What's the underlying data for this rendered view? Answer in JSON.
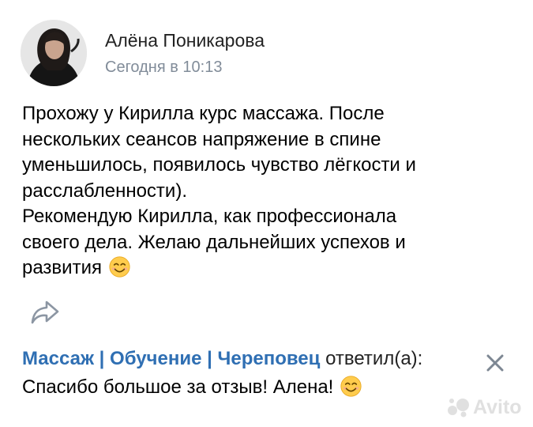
{
  "post": {
    "author": "Алёна Поникарова",
    "time": "Сегодня в 10:13",
    "lines": [
      "Прохожу у Кирилла курс массажа. После",
      "нескольких сеансов напряжение в спине",
      "уменьшилось, появилось чувство лёгкости и",
      "расслабленности).",
      "Рекомендую Кирилла, как профессионала",
      "своего дела. Желаю дальнейших успехов и",
      "развития"
    ],
    "end_emoji": "smiling-face-emoji"
  },
  "actions": {
    "share_icon": "share-icon"
  },
  "reply": {
    "group_name": "Массаж | Обучение | Череповец",
    "verb": "ответил(а):",
    "text": "Спасибо большое за отзыв! Алена!",
    "end_emoji": "smiling-face-emoji",
    "close_icon": "close-icon"
  },
  "watermark": {
    "text": "Avito"
  }
}
